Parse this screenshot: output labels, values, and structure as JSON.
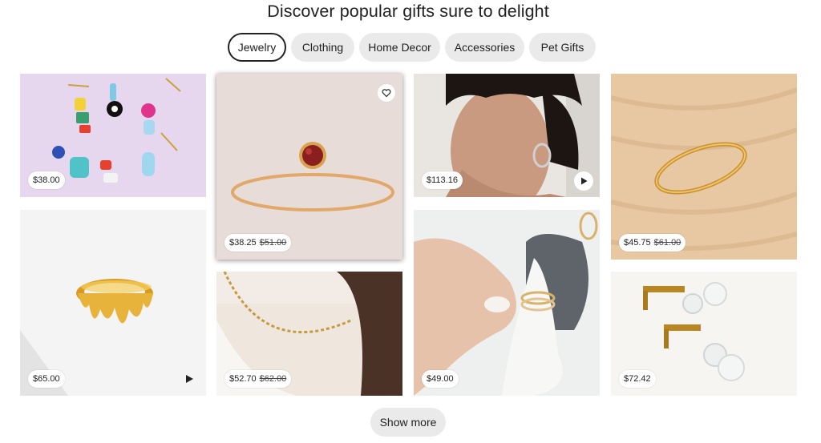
{
  "section": {
    "title": "Discover popular gifts sure to delight"
  },
  "tabs": [
    {
      "label": "Jewelry",
      "selected": true
    },
    {
      "label": "Clothing",
      "selected": false
    },
    {
      "label": "Home Decor",
      "selected": false
    },
    {
      "label": "Accessories",
      "selected": false
    },
    {
      "label": "Pet Gifts",
      "selected": false
    }
  ],
  "products": [
    {
      "id": "beaded-earrings",
      "price": "$38.00",
      "original_price": ""
    },
    {
      "id": "melting-ring",
      "price": "$65.00",
      "original_price": "",
      "media_icon": "play-icon"
    },
    {
      "id": "red-stone-ring",
      "price": "$38.25",
      "original_price": "$51.00",
      "media_icon": "heart-icon"
    },
    {
      "id": "disc-chain-necklace",
      "price": "$52.70",
      "original_price": "$62.00"
    },
    {
      "id": "oval-hoop-earring",
      "price": "$113.16",
      "original_price": "",
      "media_icon": "play-icon"
    },
    {
      "id": "stacking-rings",
      "price": "$49.00",
      "original_price": ""
    },
    {
      "id": "gold-signet-ring",
      "price": "$45.75",
      "original_price": "$61.00"
    },
    {
      "id": "crystal-bar-earrings",
      "price": "$72.42",
      "original_price": ""
    }
  ],
  "show_more": {
    "label": "Show more"
  },
  "colors": {
    "chip_bg": "#eaeaea",
    "chip_selected_border": "#222222",
    "text": "#222222"
  }
}
